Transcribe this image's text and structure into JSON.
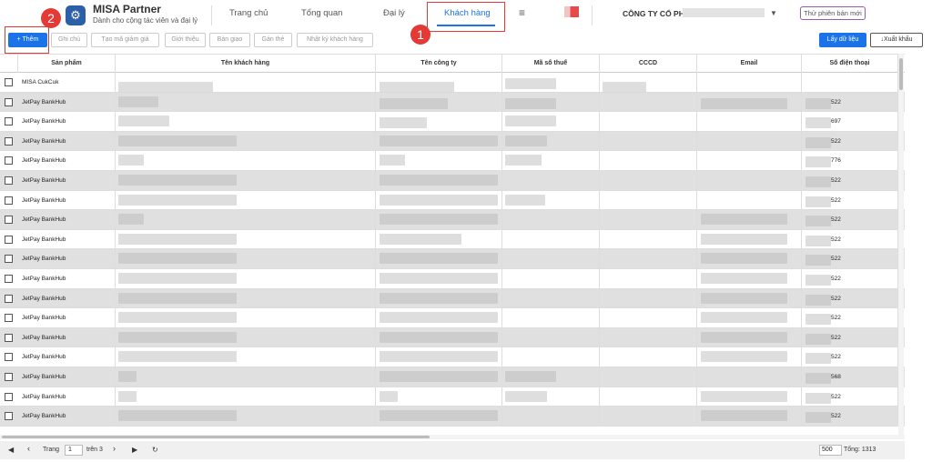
{
  "app": {
    "title": "MISA Partner",
    "subtitle": "Dành cho cộng tác viên và đại lý",
    "logo_icon": "gear-icon"
  },
  "nav": {
    "items": [
      "Trang chủ",
      "Tổng quan",
      "Đại lý",
      "Khách hàng"
    ],
    "active": "Khách hàng",
    "menu_icon": "≡"
  },
  "account": {
    "company": "CÔNG TY CỔ PHẦN",
    "try_new": "Thử phiên bản mới"
  },
  "annotations": {
    "step1": "1",
    "step2": "2",
    "color": "#e53935"
  },
  "toolbar": {
    "add": "+ Thêm",
    "note": "Ghi chú",
    "coupon": "Tạo mã giảm giá",
    "intro": "Giới thiệu",
    "handover": "Bàn giao",
    "tag": "Gán thẻ",
    "log": "Nhật ký khách hàng",
    "fetch": "Lấy dữ liệu",
    "export": "↓Xuất khẩu"
  },
  "columns": [
    "Sản phẩm",
    "Tên khách hàng",
    "Tên công ty",
    "Mã số thuế",
    "CCCD",
    "Email",
    "Số điện thoại"
  ],
  "rows": [
    {
      "product": "MISA CukCuk",
      "phone": ""
    },
    {
      "product": "JetPay BankHub",
      "phone": "522"
    },
    {
      "product": "JetPay BankHub",
      "phone": "697"
    },
    {
      "product": "JetPay BankHub",
      "phone": "522"
    },
    {
      "product": "JetPay BankHub",
      "phone": "776"
    },
    {
      "product": "JetPay BankHub",
      "phone": "522"
    },
    {
      "product": "JetPay BankHub",
      "phone": "522"
    },
    {
      "product": "JetPay BankHub",
      "phone": "522"
    },
    {
      "product": "JetPay BankHub",
      "phone": "522"
    },
    {
      "product": "JetPay BankHub",
      "phone": "522"
    },
    {
      "product": "JetPay BankHub",
      "phone": "522"
    },
    {
      "product": "JetPay BankHub",
      "phone": "522"
    },
    {
      "product": "JetPay BankHub",
      "phone": "522"
    },
    {
      "product": "JetPay BankHub",
      "phone": "522"
    },
    {
      "product": "JetPay BankHub",
      "phone": "522"
    },
    {
      "product": "JetPay BankHub",
      "phone": "568"
    },
    {
      "product": "JetPay BankHub",
      "phone": "522"
    },
    {
      "product": "JetPay BankHub",
      "phone": "522"
    }
  ],
  "pager": {
    "label": "Trang",
    "page": "1",
    "of": "trên 3",
    "page_size": "500",
    "total": "Tổng: 1313"
  },
  "colors": {
    "accent": "#1a73e8",
    "annotation": "#e53935",
    "try_border": "#9b59b6"
  }
}
